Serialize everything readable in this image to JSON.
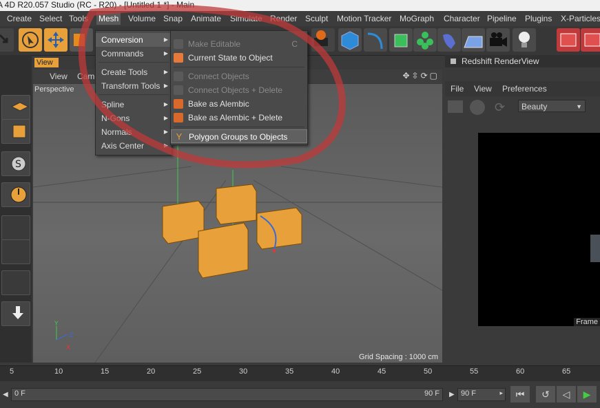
{
  "window": {
    "title": "A 4D R20.057 Studio (RC - R20) - [Untitled 1 *] - Main"
  },
  "menubar": {
    "items": [
      "Create",
      "Select",
      "Tools",
      "Mesh",
      "Volume",
      "Snap",
      "Animate",
      "Simulate",
      "Render",
      "Sculpt",
      "Motion Tracker",
      "MoGraph",
      "Character",
      "Pipeline",
      "Plugins",
      "X-Particles"
    ],
    "active": "Mesh"
  },
  "mesh_menu": {
    "items": [
      {
        "label": "Conversion",
        "submenu": true,
        "selected": true
      },
      {
        "label": "Commands",
        "submenu": true
      },
      {
        "label": "Create Tools",
        "submenu": true
      },
      {
        "label": "Transform Tools",
        "submenu": true
      },
      {
        "label": "Spline",
        "submenu": true
      },
      {
        "label": "N-Gons",
        "submenu": true
      },
      {
        "label": "Normals",
        "submenu": true
      },
      {
        "label": "Axis Center",
        "submenu": true
      }
    ]
  },
  "conversion_menu": {
    "items": [
      {
        "label": "Make Editable",
        "shortcut": "C",
        "disabled": true
      },
      {
        "label": "Current State to Object",
        "disabled": false
      },
      {
        "label": "Connect Objects",
        "disabled": true
      },
      {
        "label": "Connect Objects + Delete",
        "disabled": true
      },
      {
        "label": "Bake as Alembic",
        "disabled": false
      },
      {
        "label": "Bake as Alembic + Delete",
        "disabled": false
      },
      {
        "label": "Polygon Groups to Objects",
        "disabled": false,
        "selected": true
      }
    ]
  },
  "viewport": {
    "tab": "View",
    "menu": [
      "View",
      "Came"
    ],
    "camera_label": "Perspective",
    "grid_spacing": "Grid Spacing : 1000 cm"
  },
  "renderview": {
    "title": "Redshift RenderView",
    "menu": [
      "File",
      "View",
      "Preferences"
    ],
    "aov_select": "Beauty",
    "frame_label": "Frame"
  },
  "timeline": {
    "ticks": [
      "5",
      "10",
      "15",
      "20",
      "25",
      "30",
      "35",
      "40",
      "45",
      "50",
      "55",
      "60",
      "65"
    ],
    "start_field": "0 F",
    "end_field": "90 F",
    "end_field2": "90 F"
  },
  "colors": {
    "accent_orange": "#e7a03a",
    "annotation_red": "#c0393b",
    "menu_bg": "#4a4a4a"
  },
  "icons": {
    "toolbar": [
      "undo-icon",
      "select-icon",
      "move-icon",
      "scale-icon",
      "render-icon",
      "cube-icon",
      "spline-icon",
      "nurbs-icon",
      "cloner-icon",
      "deformer-icon",
      "floor-icon",
      "camera-icon",
      "light-icon",
      "aov-icon",
      "picture-viewer-icon"
    ]
  }
}
